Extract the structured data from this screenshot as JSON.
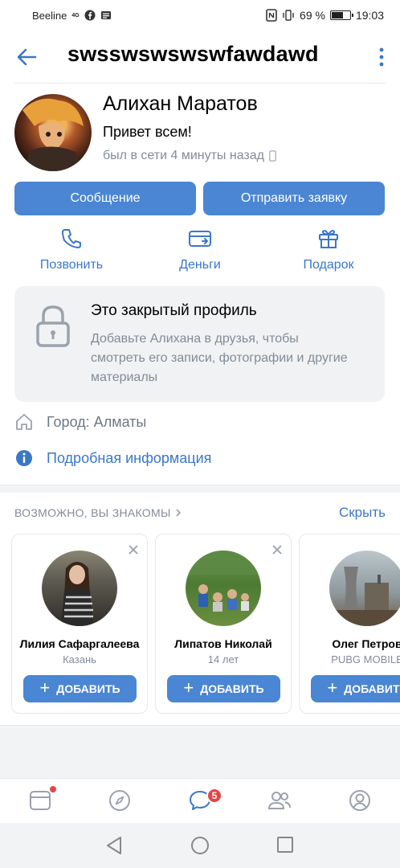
{
  "status_bar": {
    "carrier": "Beeline",
    "network": "4G",
    "battery_text": "69 %",
    "battery_level": 0.69,
    "time": "19:03"
  },
  "header": {
    "title": "swsswswswswfawdawd"
  },
  "profile": {
    "name": "Алихан Маратов",
    "status": "Привет всем!",
    "last_seen": "был в сети 4 минуты назад",
    "message_button": "Сообщение",
    "request_button": "Отправить заявку"
  },
  "actions": [
    {
      "label": "Позвонить",
      "icon": "phone-icon"
    },
    {
      "label": "Деньги",
      "icon": "money-card-icon"
    },
    {
      "label": "Подарок",
      "icon": "gift-icon"
    }
  ],
  "closed_profile": {
    "title": "Это закрытый профиль",
    "text": "Добавьте Алихана в друзья, чтобы смотреть его записи, фотографии и другие материалы"
  },
  "info": {
    "city": "Город: Алматы",
    "details_link": "Подробная информация"
  },
  "suggestions": {
    "title": "ВОЗМОЖНО, ВЫ ЗНАКОМЫ",
    "hide_label": "Скрыть",
    "add_label": "ДОБАВИТЬ",
    "people": [
      {
        "name": "Лилия Сафаргалеева",
        "sub": "Казань"
      },
      {
        "name": "Липатов Николай",
        "sub": "14 лет"
      },
      {
        "name": "Олег Петров",
        "sub": "PUBG MOBILE"
      }
    ]
  },
  "tabbar": {
    "messages_badge": "5"
  },
  "colors": {
    "accent": "#4a86d3",
    "link": "#3b77c7",
    "muted": "#818c99",
    "badge": "#e64646"
  }
}
